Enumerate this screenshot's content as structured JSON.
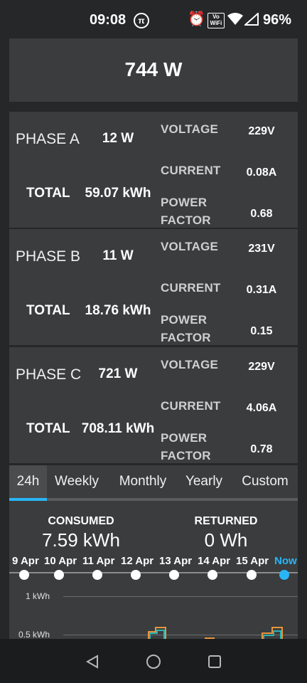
{
  "status": {
    "time": "09:08",
    "battery": "96%",
    "vowifi_top": "Vo",
    "vowifi_bottom": "WiFi"
  },
  "total_power": "744 W",
  "labels": {
    "total": "TOTAL",
    "voltage": "VOLTAGE",
    "current": "CURRENT",
    "power": "POWER",
    "factor": "FACTOR"
  },
  "phases": [
    {
      "name": "PHASE A",
      "power": "12 W",
      "total": "59.07 kWh",
      "voltage": "229V",
      "current": "0.08A",
      "power_factor": "0.68"
    },
    {
      "name": "PHASE B",
      "power": "11 W",
      "total": "18.76 kWh",
      "voltage": "231V",
      "current": "0.31A",
      "power_factor": "0.15"
    },
    {
      "name": "PHASE C",
      "power": "721 W",
      "total": "708.11 kWh",
      "voltage": "229V",
      "current": "4.06A",
      "power_factor": "0.78"
    }
  ],
  "tabs": [
    "24h",
    "Weekly",
    "Monthly",
    "Yearly",
    "Custom"
  ],
  "active_tab": "24h",
  "summary": {
    "consumed_label": "CONSUMED",
    "consumed_value": "7.59 kWh",
    "returned_label": "RETURNED",
    "returned_value": "0 Wh"
  },
  "timeline": [
    "9 Apr",
    "10 Apr",
    "11 Apr",
    "12 Apr",
    "13 Apr",
    "14 Apr",
    "15 Apr",
    "Now"
  ],
  "chart_labels": [
    "1 kWh",
    "0.5 kWh"
  ],
  "colors": {
    "background": "#252729",
    "card": "#3a3c3e",
    "accent": "#29b6f6",
    "bar_orange": "#e8953a",
    "bar_teal": "#2bb3b3"
  }
}
